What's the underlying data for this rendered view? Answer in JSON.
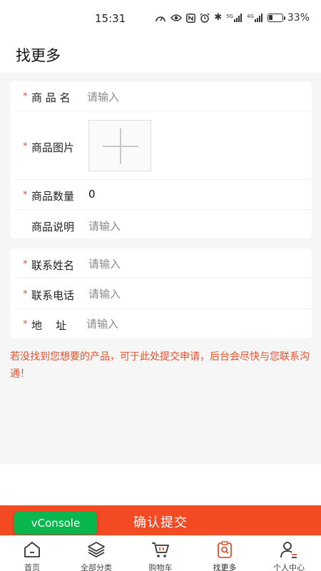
{
  "status_bar": {
    "time": "15:31",
    "network_5g": "5G",
    "network_4g": "4G",
    "battery_percent": "33%",
    "battery_level": 0.33
  },
  "header": {
    "title": "找更多"
  },
  "form": {
    "product_name": {
      "label": "商 品 名",
      "placeholder": "请输入",
      "required": true
    },
    "product_image": {
      "label": "商品图片",
      "required": true
    },
    "product_qty": {
      "label": "商品数量",
      "value": "0",
      "required": true
    },
    "product_desc": {
      "label": "商品说明",
      "placeholder": "请输入",
      "required": false
    },
    "contact_name": {
      "label": "联系姓名",
      "placeholder": "请输入",
      "required": true
    },
    "contact_phone": {
      "label": "联系电话",
      "placeholder": "请输入",
      "required": true
    },
    "address": {
      "label": "地    址",
      "placeholder": "请输入",
      "required": true
    },
    "required_mark": "*"
  },
  "notice": "若没找到您想要的产品，可于此处提交申请，后台会尽快与您联系沟通！",
  "submit_label": "确认提交",
  "vconsole_label": "vConsole",
  "tabbar": {
    "items": [
      {
        "label": "首页",
        "icon": "home-icon"
      },
      {
        "label": "全部分类",
        "icon": "layers-icon"
      },
      {
        "label": "购物车",
        "icon": "cart-icon"
      },
      {
        "label": "找更多",
        "icon": "search-bag-icon"
      },
      {
        "label": "个人中心",
        "icon": "user-icon"
      }
    ],
    "active_index": 3
  },
  "colors": {
    "accent": "#f44b25",
    "required": "#e4502c",
    "vconsole": "#0ab74f"
  }
}
